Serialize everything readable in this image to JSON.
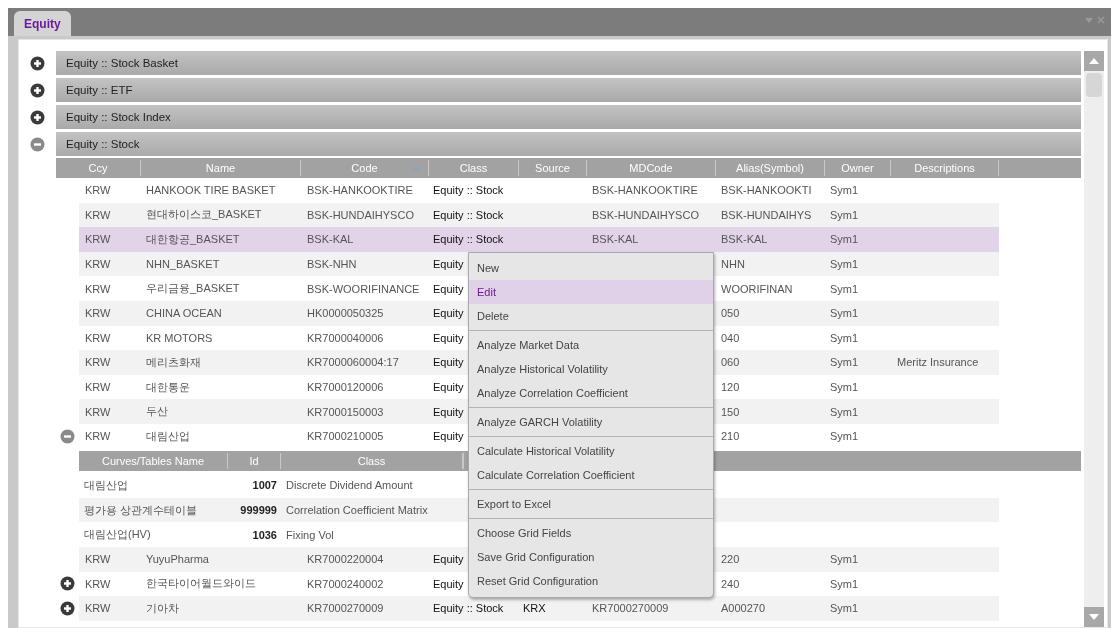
{
  "tab": {
    "label": "Equity",
    "selected": true
  },
  "sections": [
    {
      "title": "Equity :: Stock Basket",
      "expanded": false
    },
    {
      "title": "Equity :: ETF",
      "expanded": false
    },
    {
      "title": "Equity :: Stock Index",
      "expanded": false
    },
    {
      "title": "Equity :: Stock",
      "expanded": true,
      "grid": {
        "columns": [
          {
            "label": "Ccy",
            "sorted": false
          },
          {
            "label": "Name",
            "sorted": false
          },
          {
            "label": "Code",
            "sorted": true
          },
          {
            "label": "Class",
            "sorted": false
          },
          {
            "label": "Source",
            "sorted": false
          },
          {
            "label": "MDCode",
            "sorted": false
          },
          {
            "label": "Alias(Symbol)",
            "sorted": false
          },
          {
            "label": "Owner",
            "sorted": false
          },
          {
            "label": "Descriptions",
            "sorted": false
          }
        ],
        "rows": [
          {
            "selected": false,
            "cells": [
              "KRW",
              "HANKOOK TIRE BASKET",
              "BSK-HANKOOKTIRE",
              "Equity :: Stock",
              null,
              "BSK-HANKOOKTIRE",
              "BSK-HANKOOKTI",
              "Sym1",
              null
            ]
          },
          {
            "selected": false,
            "cells": [
              "KRW",
              "현대하이스코_BASKET",
              "BSK-HUNDAIHYSCO",
              "Equity :: Stock",
              null,
              "BSK-HUNDAIHYSCO",
              "BSK-HUNDAIHYS",
              "Sym1",
              null
            ]
          },
          {
            "selected": true,
            "cells": [
              "KRW",
              "대한항공_BASKET",
              "BSK-KAL",
              "Equity :: Stock",
              null,
              "BSK-KAL",
              "BSK-KAL",
              "Sym1",
              null
            ]
          },
          {
            "selected": false,
            "cells": [
              "KRW",
              "NHN_BASKET",
              "BSK-NHN",
              "Equity",
              null,
              null,
              "NHN",
              "Sym1",
              null
            ]
          },
          {
            "selected": false,
            "cells": [
              "KRW",
              "우리금융_BASKET",
              "BSK-WOORIFINANCE",
              "Equity",
              null,
              null,
              "WOORIFINAN",
              "Sym1",
              null
            ]
          },
          {
            "selected": false,
            "cells": [
              "KRW",
              "CHINA OCEAN",
              "HK0000050325",
              "Equity",
              null,
              null,
              "050",
              "Sym1",
              null
            ]
          },
          {
            "selected": false,
            "cells": [
              "KRW",
              "KR MOTORS",
              "KR7000040006",
              "Equity",
              null,
              null,
              "040",
              "Sym1",
              null
            ]
          },
          {
            "selected": false,
            "cells": [
              "KRW",
              "메리츠화재",
              "KR7000060004:17",
              "Equity",
              null,
              null,
              "060",
              "Sym1",
              "Meritz Insurance"
            ]
          },
          {
            "selected": false,
            "cells": [
              "KRW",
              "대한통운",
              "KR7000120006",
              "Equity",
              null,
              null,
              "120",
              "Sym1",
              null
            ]
          },
          {
            "selected": false,
            "cells": [
              "KRW",
              "두산",
              "KR7000150003",
              "Equity",
              null,
              null,
              "150",
              "Sym1",
              null
            ]
          },
          {
            "selected": false,
            "expanded": true,
            "cells": [
              "KRW",
              "대림산업",
              "KR7000210005",
              "Equity",
              null,
              null,
              "210",
              "Sym1",
              null
            ],
            "details": {
              "columns": [
                "Curves/Tables Name",
                "Id",
                "Class"
              ],
              "rows": [
                {
                  "cells": [
                    "대림산업",
                    "1007",
                    "Discrete Dividend Amount"
                  ]
                },
                {
                  "cells": [
                    "평가용 상관계수테이블",
                    "999999",
                    "Correlation Coefficient Matrix"
                  ]
                },
                {
                  "cells": [
                    "대림산업(HV)",
                    "1036",
                    "Fixing Vol"
                  ]
                }
              ]
            }
          },
          {
            "selected": false,
            "cells": [
              "KRW",
              "YuyuPharma",
              "KR7000220004",
              "Equity",
              null,
              null,
              "220",
              "Sym1",
              null
            ]
          },
          {
            "selected": false,
            "expanded": false,
            "cells": [
              "KRW",
              "한국타이어월드와이드",
              "KR7000240002",
              "Equity",
              null,
              null,
              "240",
              "Sym1",
              null
            ]
          },
          {
            "selected": false,
            "expanded": false,
            "cells": [
              "KRW",
              "기아차",
              "KR7000270009",
              "Equity :: Stock",
              "KRX",
              "KR7000270009",
              "A000270",
              "Sym1",
              null
            ]
          }
        ]
      }
    }
  ],
  "context_menu": {
    "groups": [
      [
        {
          "label": "New",
          "selected": false
        },
        {
          "label": "Edit",
          "selected": true
        },
        {
          "label": "Delete",
          "selected": false
        }
      ],
      [
        {
          "label": "Analyze Market Data",
          "selected": false
        },
        {
          "label": "Analyze Historical Volatility",
          "selected": false
        },
        {
          "label": "Analyze Correlation Coefficient",
          "selected": false
        }
      ],
      [
        {
          "label": "Analyze GARCH Volatility",
          "selected": false
        }
      ],
      [
        {
          "label": "Calculate Historical Volatility",
          "selected": false
        },
        {
          "label": "Calculate Correlation Coefficient",
          "selected": false
        }
      ],
      [
        {
          "label": "Export to Excel",
          "selected": false
        }
      ],
      [
        {
          "label": "Choose Grid Fields",
          "selected": false
        },
        {
          "label": "Save Grid Configuration",
          "selected": false
        },
        {
          "label": "Reset Grid Configuration",
          "selected": false
        }
      ]
    ]
  }
}
